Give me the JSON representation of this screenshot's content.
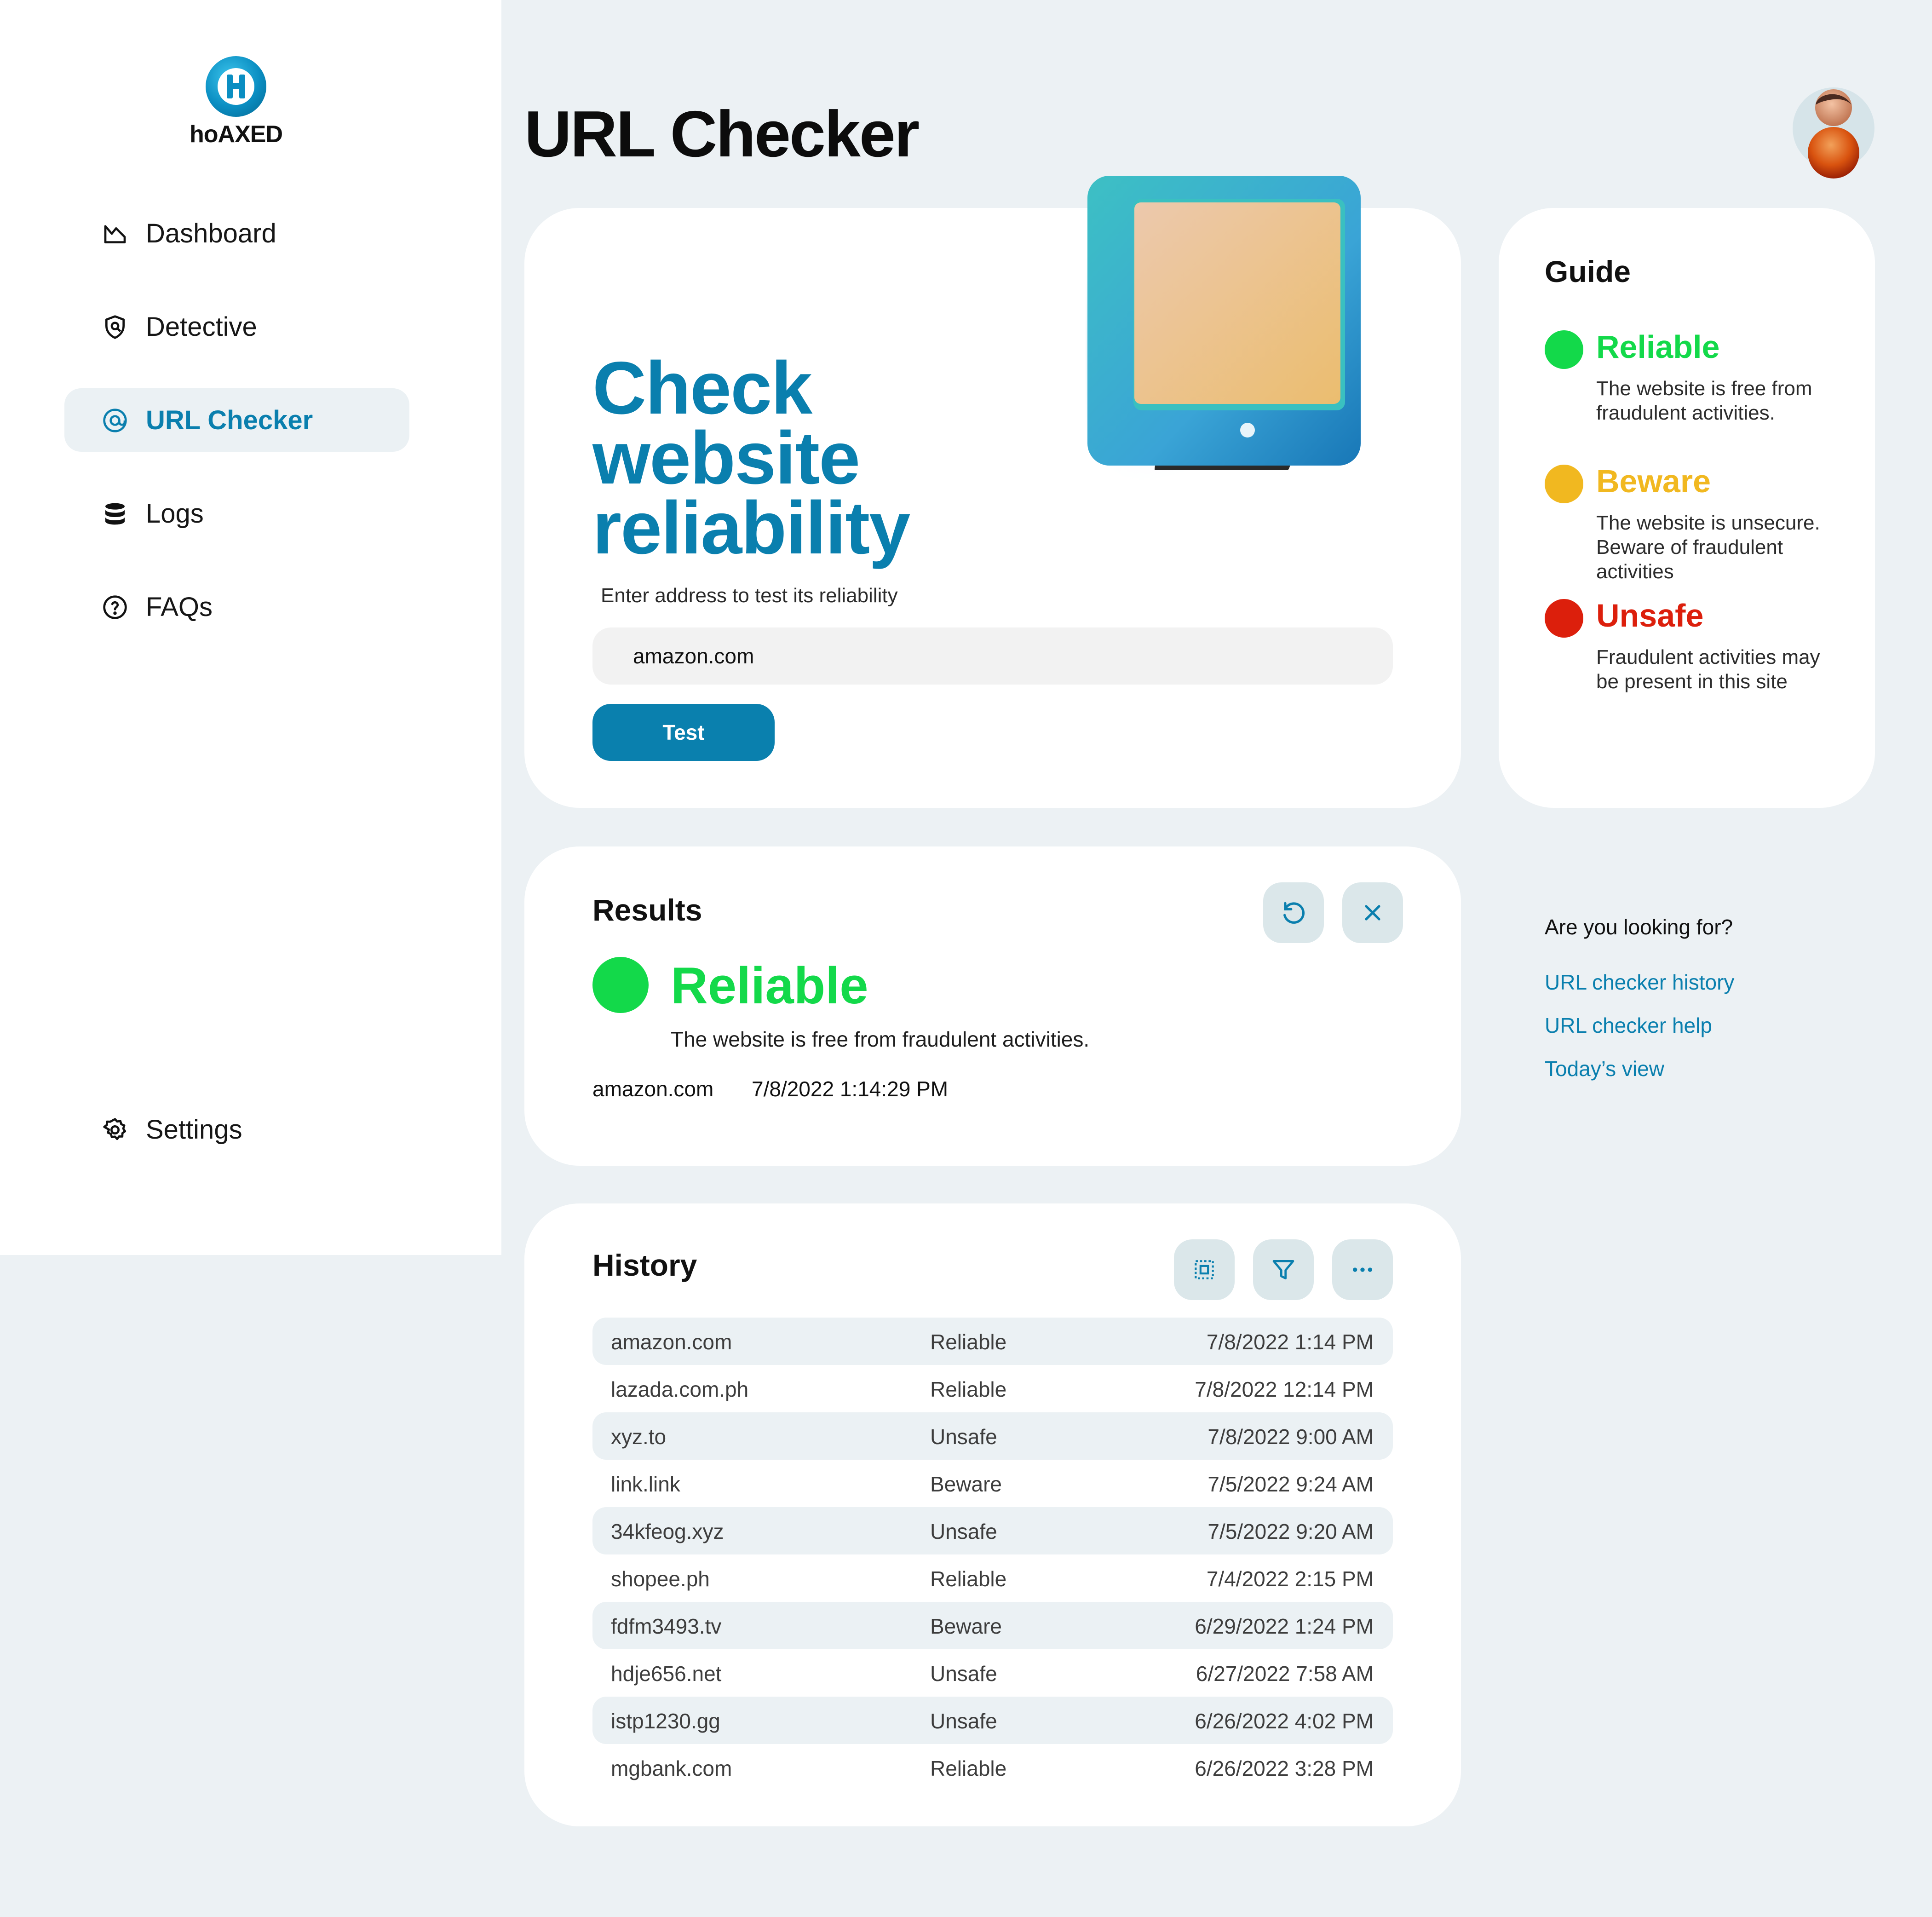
{
  "app": {
    "logo_text": "hoAXED"
  },
  "sidebar": {
    "items": [
      {
        "label": "Dashboard",
        "icon": "chart-icon"
      },
      {
        "label": "Detective",
        "icon": "shield-icon"
      },
      {
        "label": "URL Checker",
        "icon": "at-icon",
        "active": true
      },
      {
        "label": "Logs",
        "icon": "database-icon"
      },
      {
        "label": "FAQs",
        "icon": "help-icon"
      }
    ],
    "settings_label": "Settings"
  },
  "header": {
    "title": "URL Checker"
  },
  "hero": {
    "title_line1": "Check",
    "title_line2": "website",
    "title_line3": "reliability",
    "subtitle": "Enter address to test its reliability",
    "input_value": "amazon.com",
    "button_label": "Test"
  },
  "guide": {
    "title": "Guide",
    "items": [
      {
        "name": "Reliable",
        "desc": "The website is free from fraudulent activities.",
        "color": "#13d94a"
      },
      {
        "name": "Beware",
        "desc": "The website is unsecure. Beware of fraudulent activities",
        "color": "#f1b820"
      },
      {
        "name": "Unsafe",
        "desc": "Fraudulent activities may be present in this site",
        "color": "#dc1f0c"
      }
    ]
  },
  "results": {
    "title": "Results",
    "status": "Reliable",
    "status_color": "#13d94a",
    "description": "The website is free from fraudulent activities.",
    "url": "amazon.com",
    "timestamp": "7/8/2022 1:14:29 PM"
  },
  "history": {
    "title": "History",
    "rows": [
      {
        "url": "amazon.com",
        "status": "Reliable",
        "date": "7/8/2022 1:14 PM"
      },
      {
        "url": "lazada.com.ph",
        "status": "Reliable",
        "date": "7/8/2022 12:14 PM"
      },
      {
        "url": "xyz.to",
        "status": "Unsafe",
        "date": "7/8/2022 9:00 AM"
      },
      {
        "url": "link.link",
        "status": "Beware",
        "date": "7/5/2022 9:24 AM"
      },
      {
        "url": "34kfeog.xyz",
        "status": "Unsafe",
        "date": "7/5/2022 9:20 AM"
      },
      {
        "url": "shopee.ph",
        "status": "Reliable",
        "date": "7/4/2022 2:15 PM"
      },
      {
        "url": "fdfm3493.tv",
        "status": "Beware",
        "date": "6/29/2022 1:24 PM"
      },
      {
        "url": "hdje656.net",
        "status": "Unsafe",
        "date": "6/27/2022 7:58 AM"
      },
      {
        "url": "istp1230.gg",
        "status": "Unsafe",
        "date": "6/26/2022 4:02 PM"
      },
      {
        "url": "mgbank.com",
        "status": "Reliable",
        "date": "6/26/2022 3:28 PM"
      }
    ]
  },
  "looking_for": {
    "title": "Are you looking for?",
    "links": [
      "URL checker history",
      "URL checker help",
      "Today’s view"
    ]
  },
  "colors": {
    "accent": "#0a7fae",
    "reliable": "#13d94a",
    "beware": "#f1b820",
    "unsafe": "#dc1f0c"
  }
}
